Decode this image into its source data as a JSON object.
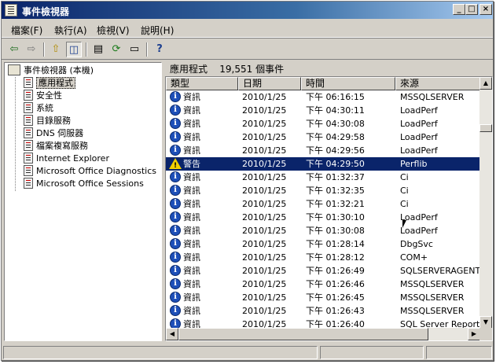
{
  "window": {
    "title": "事件檢視器",
    "minimize_glyph": "_",
    "maximize_glyph": "□",
    "close_glyph": "×"
  },
  "menu": [
    "檔案(F)",
    "執行(A)",
    "檢視(V)",
    "說明(H)"
  ],
  "toolbar": {
    "icons": [
      "back-arrow-icon",
      "forward-arrow-icon",
      "up-folder-icon",
      "show-hide-tree-icon",
      "properties-icon",
      "refresh-icon",
      "export-list-icon",
      "help-icon"
    ],
    "back_glyph": "⇦",
    "forward_glyph": "⇨",
    "up_glyph": "⇧",
    "tree_glyph": "◫",
    "properties_glyph": "▤",
    "refresh_glyph": "⟳",
    "export_glyph": "▭",
    "help_glyph": "?"
  },
  "tree": {
    "root": "事件檢視器 (本機)",
    "items": [
      "應用程式",
      "安全性",
      "系統",
      "目錄服務",
      "DNS 伺服器",
      "檔案複寫服務",
      "Internet Explorer",
      "Microsoft Office Diagnostics",
      "Microsoft Office Sessions"
    ],
    "selected": "應用程式"
  },
  "list": {
    "header_name": "應用程式",
    "header_count": "19,551 個事件",
    "columns": [
      "類型",
      "日期",
      "時間",
      "來源"
    ],
    "rows": [
      {
        "type": "資訊",
        "level": "info",
        "date": "2010/1/25",
        "time": "下午 06:16:15",
        "source": "MSSQLSERVER"
      },
      {
        "type": "資訊",
        "level": "info",
        "date": "2010/1/25",
        "time": "下午 04:30:11",
        "source": "LoadPerf"
      },
      {
        "type": "資訊",
        "level": "info",
        "date": "2010/1/25",
        "time": "下午 04:30:08",
        "source": "LoadPerf"
      },
      {
        "type": "資訊",
        "level": "info",
        "date": "2010/1/25",
        "time": "下午 04:29:58",
        "source": "LoadPerf"
      },
      {
        "type": "資訊",
        "level": "info",
        "date": "2010/1/25",
        "time": "下午 04:29:56",
        "source": "LoadPerf"
      },
      {
        "type": "警告",
        "level": "warning",
        "date": "2010/1/25",
        "time": "下午 04:29:50",
        "source": "Perflib"
      },
      {
        "type": "資訊",
        "level": "info",
        "date": "2010/1/25",
        "time": "下午 01:32:37",
        "source": "Ci"
      },
      {
        "type": "資訊",
        "level": "info",
        "date": "2010/1/25",
        "time": "下午 01:32:35",
        "source": "Ci"
      },
      {
        "type": "資訊",
        "level": "info",
        "date": "2010/1/25",
        "time": "下午 01:32:21",
        "source": "Ci"
      },
      {
        "type": "資訊",
        "level": "info",
        "date": "2010/1/25",
        "time": "下午 01:30:10",
        "source": "LoadPerf"
      },
      {
        "type": "資訊",
        "level": "info",
        "date": "2010/1/25",
        "time": "下午 01:30:08",
        "source": "LoadPerf"
      },
      {
        "type": "資訊",
        "level": "info",
        "date": "2010/1/25",
        "time": "下午 01:28:14",
        "source": "DbgSvc"
      },
      {
        "type": "資訊",
        "level": "info",
        "date": "2010/1/25",
        "time": "下午 01:28:12",
        "source": "COM+"
      },
      {
        "type": "資訊",
        "level": "info",
        "date": "2010/1/25",
        "time": "下午 01:26:49",
        "source": "SQLSERVERAGENT"
      },
      {
        "type": "資訊",
        "level": "info",
        "date": "2010/1/25",
        "time": "下午 01:26:46",
        "source": "MSSQLSERVER"
      },
      {
        "type": "資訊",
        "level": "info",
        "date": "2010/1/25",
        "time": "下午 01:26:45",
        "source": "MSSQLSERVER"
      },
      {
        "type": "資訊",
        "level": "info",
        "date": "2010/1/25",
        "time": "下午 01:26:43",
        "source": "MSSQLSERVER"
      },
      {
        "type": "資訊",
        "level": "info",
        "date": "2010/1/25",
        "time": "下午 01:26:40",
        "source": "SQL Server Report Se"
      }
    ],
    "selected_row": 5,
    "scroll_up_glyph": "▲",
    "scroll_down_glyph": "▼",
    "scroll_left_glyph": "◀",
    "scroll_right_glyph": "▶",
    "info_glyph": "i",
    "warning_glyph": "!"
  },
  "colors": {
    "title_start": "#0a246a",
    "title_end": "#a6caf0",
    "selection": "#0a246a",
    "warning": "#f2d000",
    "info": "#1d4fb8"
  }
}
